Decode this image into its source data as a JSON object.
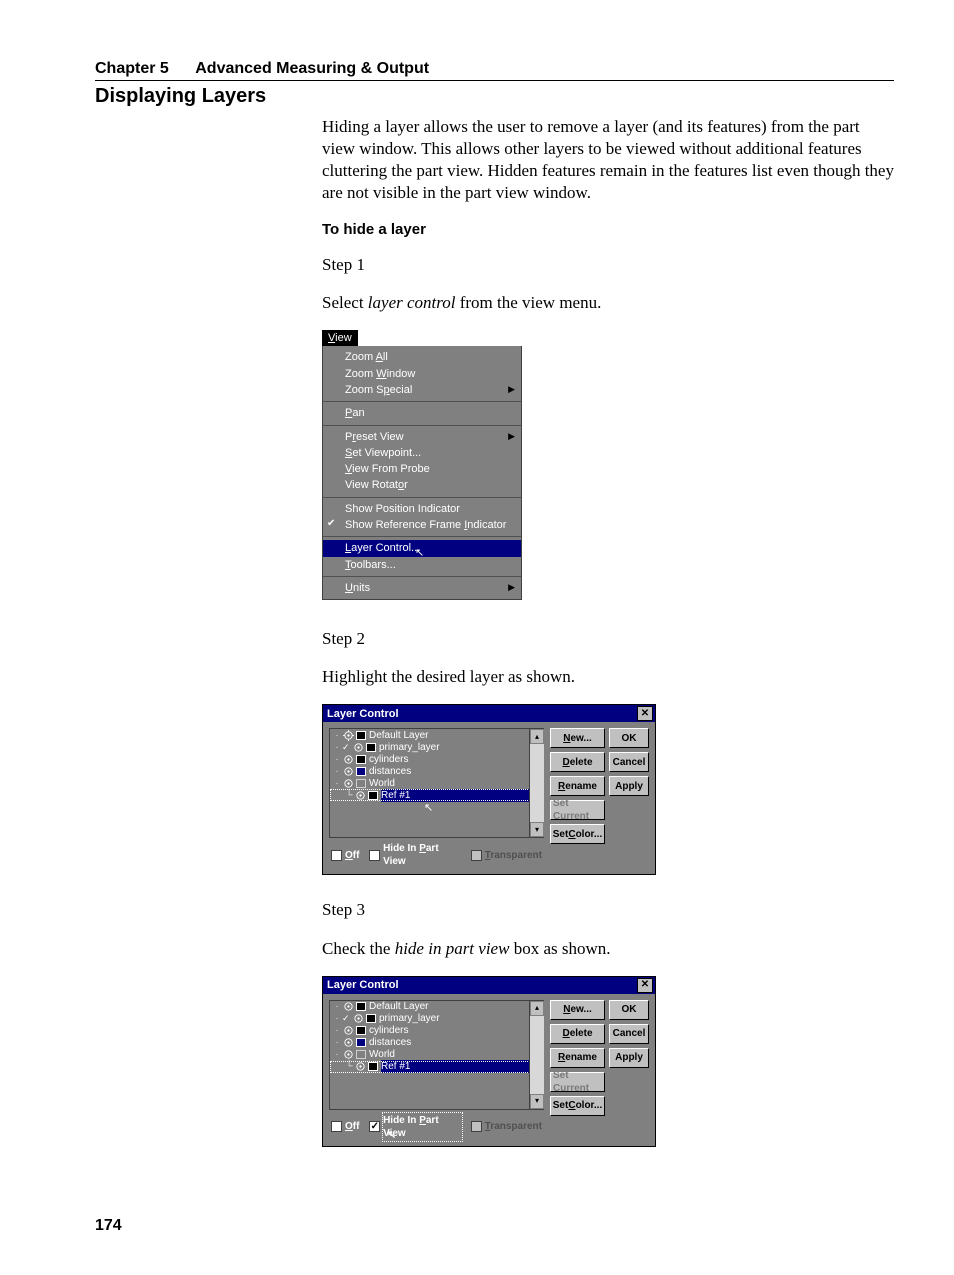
{
  "chapter": {
    "part_a": "Chapter 5",
    "part_b": "Advanced Measuring & Output"
  },
  "section": "Displaying Layers",
  "intro": "Hiding a layer allows the user to remove a layer (and its features) from the part view window.  This allows other layers to be viewed without additional features cluttering the part view.  Hidden features remain in the features list even though they are not visible in the part view window.",
  "sub_heading": "To hide a layer",
  "steps": {
    "s1": {
      "label": "Step 1",
      "text_a": "Select ",
      "text_i": "layer control",
      "text_b": " from the view menu."
    },
    "s2": {
      "label": "Step 2",
      "text": "Highlight the desired layer as shown."
    },
    "s3": {
      "label": "Step 3",
      "text_a": "Check the ",
      "text_i": "hide in part view",
      "text_b": " box as shown."
    }
  },
  "view_menu": {
    "title_accel": "V",
    "title_rest": "iew",
    "items": {
      "zoom_all": "Zoom All",
      "zoom_window": "Zoom Window",
      "zoom_special": "Zoom Special",
      "pan": "Pan",
      "preset_view": "Preset View",
      "set_viewpoint": "Set Viewpoint...",
      "view_from_probe": "View From Probe",
      "view_rotator": "View Rotator",
      "show_pos": "Show Position Indicator",
      "show_ref": "Show Reference Frame Indicator",
      "layer_control": "Layer Control...",
      "toolbars": "Toolbars...",
      "units": "Units"
    }
  },
  "lc": {
    "title": "Layer Control",
    "layers": {
      "default": "Default Layer",
      "primary": "primary_layer",
      "cylinders": "cylinders",
      "distances": "distances",
      "world": "World",
      "ref1": "Ref #1"
    },
    "buttons": {
      "new": "New...",
      "new_accel": "N",
      "delete": "Delete",
      "delete_accel": "D",
      "rename": "Rename",
      "rename_accel": "R",
      "set_current": "Set Current",
      "set_current_short": "Set Current",
      "set_color": "Set Color...",
      "set_color_accel": "C",
      "ok": "OK",
      "cancel": "Cancel",
      "apply": "Apply"
    },
    "checks": {
      "off": "Off",
      "off_accel": "O",
      "hide": "Hide In Part View",
      "hide_accel_word": "P",
      "trans": "Transparent",
      "trans_accel": "T"
    }
  },
  "page_number": "174"
}
